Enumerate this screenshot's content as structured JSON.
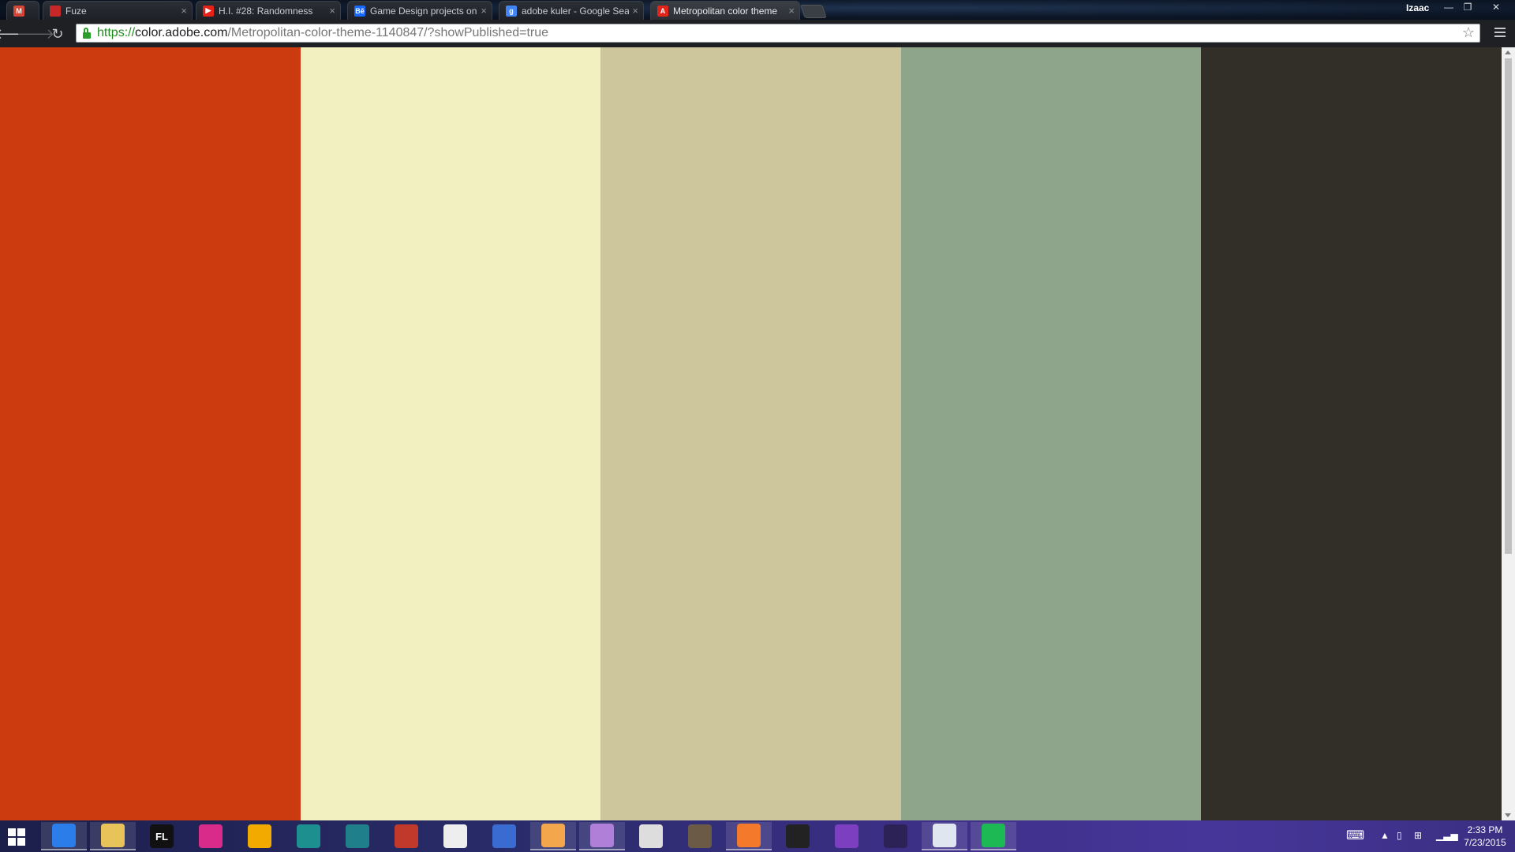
{
  "browser": {
    "user_name": "Izaac",
    "tabs": [
      {
        "title": "",
        "favicon": "gmail-icon",
        "favicon_color": "#d44638"
      },
      {
        "title": "Fuze",
        "favicon": "fuze-icon",
        "favicon_color": "#c62828"
      },
      {
        "title": "H.I. #28: Randomness",
        "favicon": "youtube-icon",
        "favicon_color": "#e62117"
      },
      {
        "title": "Game Design projects on",
        "favicon": "behance-icon",
        "favicon_color": "#1769ff"
      },
      {
        "title": "adobe kuler - Google Sea",
        "favicon": "google-icon",
        "favicon_color": "#4285f4"
      },
      {
        "title": "Metropolitan color theme",
        "favicon": "adobe-icon",
        "favicon_color": "#e1251b"
      }
    ],
    "url": {
      "scheme": "https://",
      "host": "color.adobe.com",
      "path": "/Metropolitan-color-theme-1140847/?showPublished=true"
    }
  },
  "theme": {
    "swatches": [
      {
        "color": "#cc3a10"
      },
      {
        "color": "#f2f0c1"
      },
      {
        "color": "#cdc59b"
      },
      {
        "color": "#8fa58b"
      },
      {
        "color": "#322f28"
      }
    ]
  },
  "taskbar": {
    "apps": [
      {
        "name": "chrome-icon",
        "label": "",
        "color": "#2b7de9",
        "open": true
      },
      {
        "name": "file-explorer-icon",
        "label": "",
        "color": "#e8c35a",
        "open": true
      },
      {
        "name": "fl-studio-icon",
        "label": "FL",
        "color": "#111111",
        "open": false
      },
      {
        "name": "color-app-icon",
        "label": "",
        "color": "#d92b8a",
        "open": false
      },
      {
        "name": "game-icon",
        "label": "",
        "color": "#f2a900",
        "open": false
      },
      {
        "name": "maya-icon",
        "label": "",
        "color": "#1d8f8f",
        "open": false
      },
      {
        "name": "3ds-max-icon",
        "label": "",
        "color": "#1f7f8a",
        "open": false
      },
      {
        "name": "mudbox-icon",
        "label": "",
        "color": "#c0392b",
        "open": false
      },
      {
        "name": "onenote-icon",
        "label": "",
        "color": "#eeeeee",
        "open": false
      },
      {
        "name": "paint-icon",
        "label": "",
        "color": "#3a6bd1",
        "open": false
      },
      {
        "name": "flower-app-icon",
        "label": "",
        "color": "#f3a64b",
        "open": true
      },
      {
        "name": "orb-app-icon",
        "label": "",
        "color": "#b07fd8",
        "open": true
      },
      {
        "name": "speed-app-icon",
        "label": "",
        "color": "#dddddd",
        "open": false
      },
      {
        "name": "gimp-icon",
        "label": "",
        "color": "#6b5a45",
        "open": false
      },
      {
        "name": "blender-icon",
        "label": "",
        "color": "#f5792a",
        "open": true
      },
      {
        "name": "unity-icon",
        "label": "",
        "color": "#222222",
        "open": false
      },
      {
        "name": "visual-studio-icon",
        "label": "",
        "color": "#7b3fbf",
        "open": false
      },
      {
        "name": "eclipse-icon",
        "label": "",
        "color": "#2c2255",
        "open": false
      },
      {
        "name": "window-app-icon",
        "label": "",
        "color": "#dfe6ef",
        "open": true
      },
      {
        "name": "spotify-icon",
        "label": "",
        "color": "#1db954",
        "open": true
      }
    ],
    "time": "2:33 PM",
    "date": "7/23/2015"
  }
}
